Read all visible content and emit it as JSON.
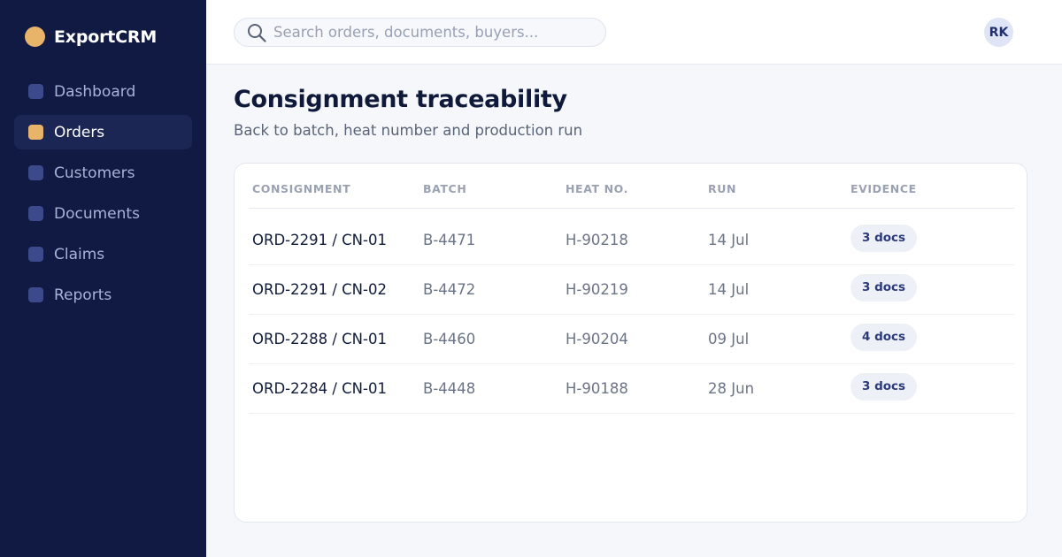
{
  "app": {
    "name": "ExportCRM",
    "brand_color": "#e8b46a",
    "sidebar_bg": "#101a42"
  },
  "sidebar": {
    "items": [
      {
        "label": "Dashboard",
        "active": false
      },
      {
        "label": "Orders",
        "active": true
      },
      {
        "label": "Customers",
        "active": false
      },
      {
        "label": "Documents",
        "active": false
      },
      {
        "label": "Claims",
        "active": false
      },
      {
        "label": "Reports",
        "active": false
      }
    ]
  },
  "topbar": {
    "search": {
      "placeholder": "Search orders, documents, buyers...",
      "value": "",
      "icon": "search-icon"
    },
    "avatar_initials": "RK"
  },
  "page": {
    "title": "Consignment traceability",
    "subtitle": "Back to batch, heat number and production run"
  },
  "table": {
    "columns": [
      "CONSIGNMENT",
      "BATCH",
      "HEAT NO.",
      "RUN",
      "EVIDENCE"
    ],
    "rows": [
      {
        "consignment": "ORD-2291 / CN-01",
        "batch": "B-4471",
        "heat": "H-90218",
        "run": "14 Jul",
        "evidence": "3 docs"
      },
      {
        "consignment": "ORD-2291 / CN-02",
        "batch": "B-4472",
        "heat": "H-90219",
        "run": "14 Jul",
        "evidence": "3 docs"
      },
      {
        "consignment": "ORD-2288 / CN-01",
        "batch": "B-4460",
        "heat": "H-90204",
        "run": "09 Jul",
        "evidence": "4 docs"
      },
      {
        "consignment": "ORD-2284 / CN-01",
        "batch": "B-4448",
        "heat": "H-90188",
        "run": "28 Jun",
        "evidence": "3 docs"
      }
    ]
  }
}
